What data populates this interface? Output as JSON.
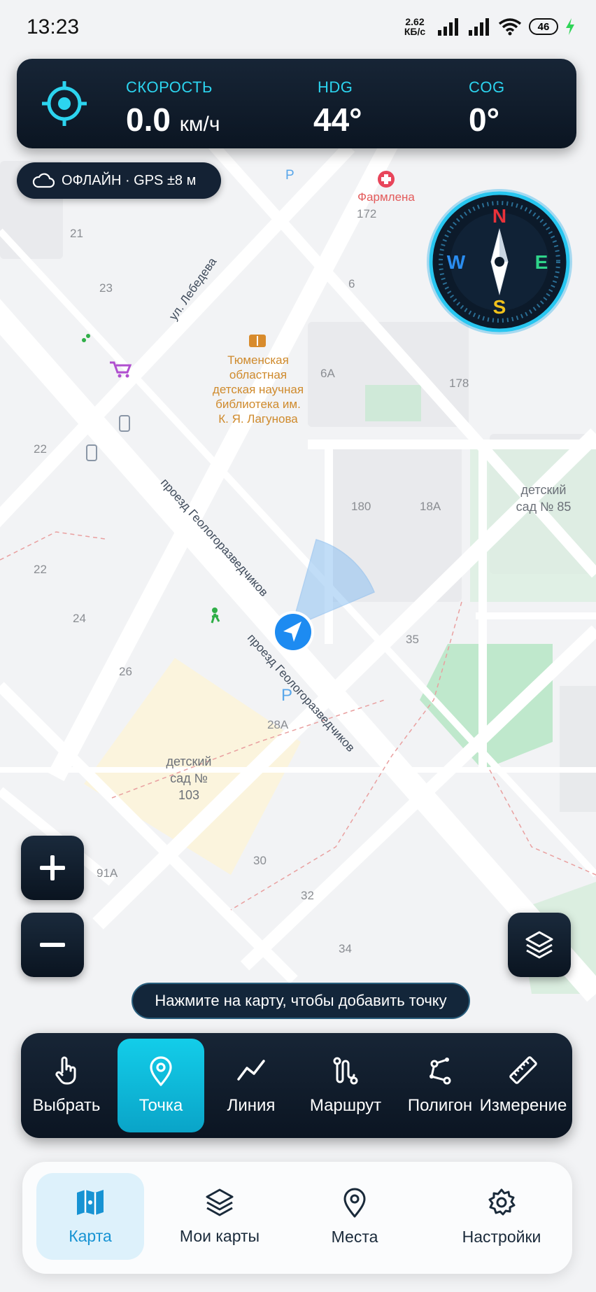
{
  "status_bar": {
    "time": "13:23",
    "net_speed_value": "2.62",
    "net_speed_unit": "КБ/с",
    "battery": "46"
  },
  "telemetry": {
    "speed_label": "СКОРОСТЬ",
    "speed_value": "0.0",
    "speed_unit": "км/ч",
    "hdg_label": "HDG",
    "hdg_value": "44°",
    "cog_label": "COG",
    "cog_value": "0°"
  },
  "offline_badge": {
    "text": "ОФЛАЙН · GPS ±8 м"
  },
  "compass": {
    "n": "N",
    "e": "E",
    "s": "S",
    "w": "W"
  },
  "map": {
    "house_numbers": [
      "21",
      "23",
      "22",
      "22",
      "24",
      "26",
      "6",
      "172",
      "6А",
      "178",
      "180",
      "18А",
      "35",
      "28А",
      "30",
      "32",
      "34",
      "91А"
    ],
    "streets": [
      "ул. Лебедева",
      "проезд Геологоразведчиков",
      "проезд Геологоразведчиков"
    ],
    "pois": {
      "pharmacy": "Фармлена",
      "library": "Тюменская областная детская научная библиотека им. К. Я. Лагунова",
      "kindergarten_85": "детский сад № 85",
      "kindergarten_103": "детский сад № 103"
    },
    "parking_letter": "P"
  },
  "hint": "Нажмите на карту, чтобы добавить точку",
  "tools": [
    {
      "label": "Выбрать",
      "icon": "hand-pointer-icon"
    },
    {
      "label": "Точка",
      "icon": "map-pin-icon",
      "active": true
    },
    {
      "label": "Линия",
      "icon": "polyline-icon"
    },
    {
      "label": "Маршрут",
      "icon": "route-icon"
    },
    {
      "label": "Полигон",
      "icon": "polygon-icon"
    },
    {
      "label": "Измерение",
      "icon": "ruler-icon"
    }
  ],
  "nav": [
    {
      "label": "Карта",
      "icon": "map-icon",
      "active": true
    },
    {
      "label": "Мои карты",
      "icon": "layers-icon"
    },
    {
      "label": "Места",
      "icon": "place-pin-icon"
    },
    {
      "label": "Настройки",
      "icon": "gear-icon"
    }
  ],
  "colors": {
    "accent": "#2cd4ef",
    "panel": "#0f1c2b",
    "tool_active": "#13c4e4",
    "nav_active": "#1793d3",
    "compass_north": "#e8323a",
    "compass_east": "#2fd48a",
    "compass_west": "#2a8df0",
    "compass_south": "#f2c21b"
  }
}
